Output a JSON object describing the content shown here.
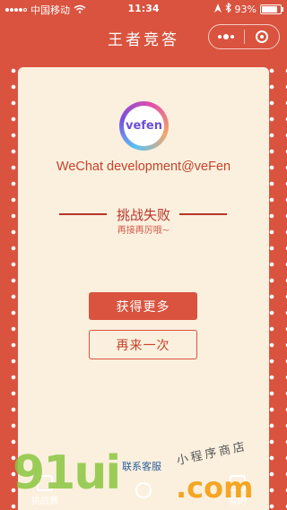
{
  "status_bar": {
    "carrier": "中国移动",
    "time": "11:34",
    "battery": "93%",
    "battery_level": 0.93
  },
  "nav": {
    "title": "王者竞答",
    "menu_icon": "more-dots-icon",
    "close_icon": "target-circle-icon"
  },
  "profile": {
    "logo_text": "vefen",
    "username": "WeChat development@veFen"
  },
  "result": {
    "title": "挑战失败",
    "subtitle": "再接再厉哦~"
  },
  "actions": {
    "more_label": "获得更多",
    "retry_label": "再来一次"
  },
  "contact": {
    "label": "联系客服"
  },
  "bottom_tabs": [
    {
      "label": "挑战赛"
    },
    {
      "label": ""
    },
    {
      "label": "我的"
    }
  ],
  "watermark": {
    "brand_number": "91ui",
    "brand_suffix": ".com",
    "brand_tagline": "小程序商店"
  },
  "colors": {
    "primary": "#d9533f",
    "card": "#fbf0de",
    "accent_text": "#b7352a"
  }
}
